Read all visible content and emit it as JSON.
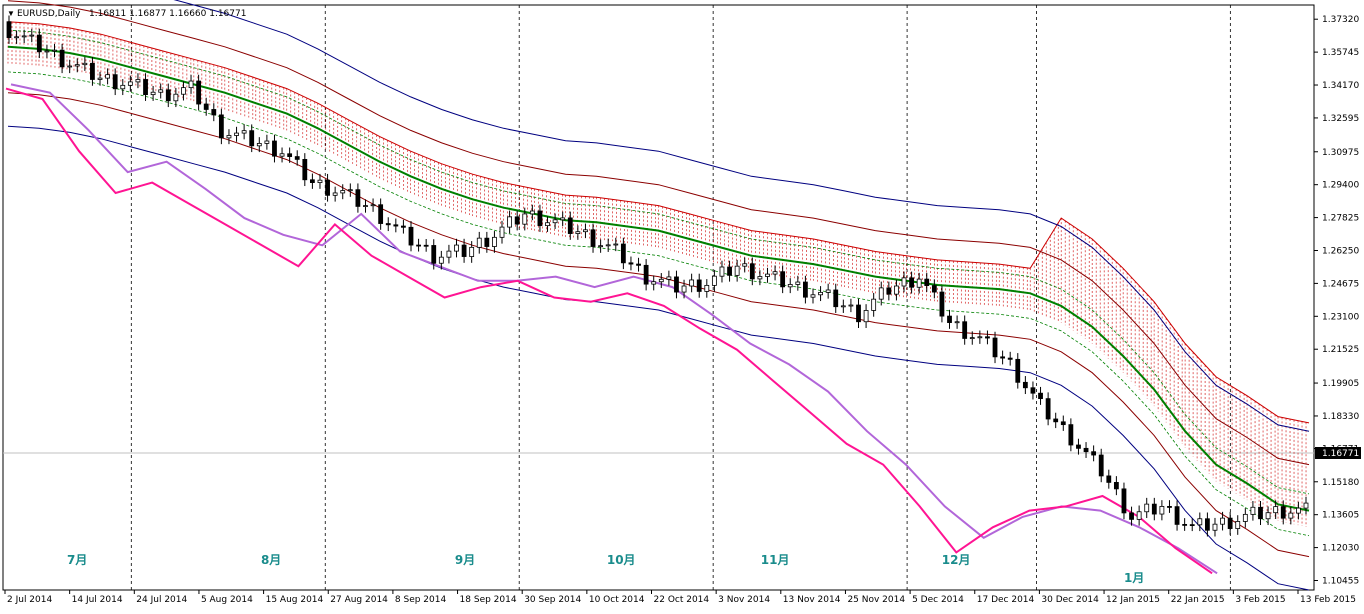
{
  "title": {
    "symbol": "EURUSD,Daily",
    "ohlc": "1.16811 1.16877 1.16660 1.16771"
  },
  "current_price_label": "1.16771",
  "colors": {
    "background": "#ffffff",
    "sma": "#008000",
    "bollinger_outer": "#000080",
    "bollinger_inner": "#8b0000",
    "envelope_dotted": "#008000",
    "cloud_hatch": "#cc0000",
    "chikou_pink": "#ff1493",
    "chikou_violet": "#b266d9",
    "month_label": "#1a8c8c",
    "candle_up": "#ffffff",
    "candle_down": "#000000"
  },
  "chart_data": {
    "type": "line",
    "instrument": "EURUSD",
    "timeframe": "Daily",
    "ylim": [
      1.1,
      1.38
    ],
    "y_ticks": [
      "1.37320",
      "1.35745",
      "1.34170",
      "1.32595",
      "1.30975",
      "1.29400",
      "1.27825",
      "1.26250",
      "1.24675",
      "1.23100",
      "1.21525",
      "1.19905",
      "1.18330",
      "1.16771",
      "1.15180",
      "1.13605",
      "1.12030",
      "1.10455"
    ],
    "x_ticks": [
      "2 Jul 2014",
      "14 Jul 2014",
      "24 Jul 2014",
      "5 Aug 2014",
      "15 Aug 2014",
      "27 Aug 2014",
      "8 Sep 2014",
      "18 Sep 2014",
      "30 Sep 2014",
      "10 Oct 2014",
      "22 Oct 2014",
      "3 Nov 2014",
      "13 Nov 2014",
      "25 Nov 2014",
      "5 Dec 2014",
      "17 Dec 2014",
      "30 Dec 2014",
      "12 Jan 2015",
      "22 Jan 2015",
      "3 Feb 2015",
      "13 Feb 2015"
    ],
    "month_labels": [
      "7月",
      "8月",
      "9月",
      "10月",
      "11月",
      "12月",
      "1月"
    ],
    "sma": [
      1.36,
      1.359,
      1.357,
      1.354,
      1.35,
      1.346,
      1.342,
      1.338,
      1.333,
      1.328,
      1.321,
      1.313,
      1.305,
      1.298,
      1.292,
      1.287,
      1.283,
      1.28,
      1.277,
      1.276,
      1.274,
      1.272,
      1.268,
      1.264,
      1.26,
      1.258,
      1.256,
      1.253,
      1.25,
      1.248,
      1.246,
      1.245,
      1.244,
      1.242,
      1.236,
      1.226,
      1.212,
      1.196,
      1.176,
      1.16,
      1.151,
      1.141,
      1.138
    ],
    "close_samples": [
      1.368,
      1.36,
      1.352,
      1.345,
      1.342,
      1.337,
      1.34,
      1.32,
      1.315,
      1.31,
      1.295,
      1.29,
      1.282,
      1.27,
      1.26,
      1.262,
      1.27,
      1.28,
      1.276,
      1.27,
      1.262,
      1.25,
      1.245,
      1.247,
      1.255,
      1.25,
      1.245,
      1.24,
      1.232,
      1.244,
      1.25,
      1.228,
      1.22,
      1.208,
      1.188,
      1.173,
      1.157,
      1.135,
      1.14,
      1.13,
      1.132,
      1.136,
      1.138
    ],
    "chikou_pink": [
      1.34,
      1.335,
      1.31,
      1.29,
      1.295,
      1.285,
      1.275,
      1.265,
      1.255,
      1.275,
      1.26,
      1.25,
      1.24,
      1.245,
      1.248,
      1.24,
      1.238,
      1.242,
      1.236,
      1.225,
      1.215,
      1.2,
      1.185,
      1.17,
      1.16,
      1.14,
      1.118,
      1.13,
      1.138,
      1.14,
      1.145,
      1.135,
      1.12,
      1.108
    ],
    "chikou_violet": [
      1.342,
      1.338,
      1.32,
      1.3,
      1.305,
      1.292,
      1.278,
      1.27,
      1.265,
      1.28,
      1.262,
      1.255,
      1.248,
      1.248,
      1.25,
      1.245,
      1.25,
      1.245,
      1.232,
      1.218,
      1.208,
      1.195,
      1.176,
      1.16,
      1.14,
      1.125,
      1.135,
      1.14,
      1.138,
      1.13,
      1.12,
      1.108
    ]
  }
}
